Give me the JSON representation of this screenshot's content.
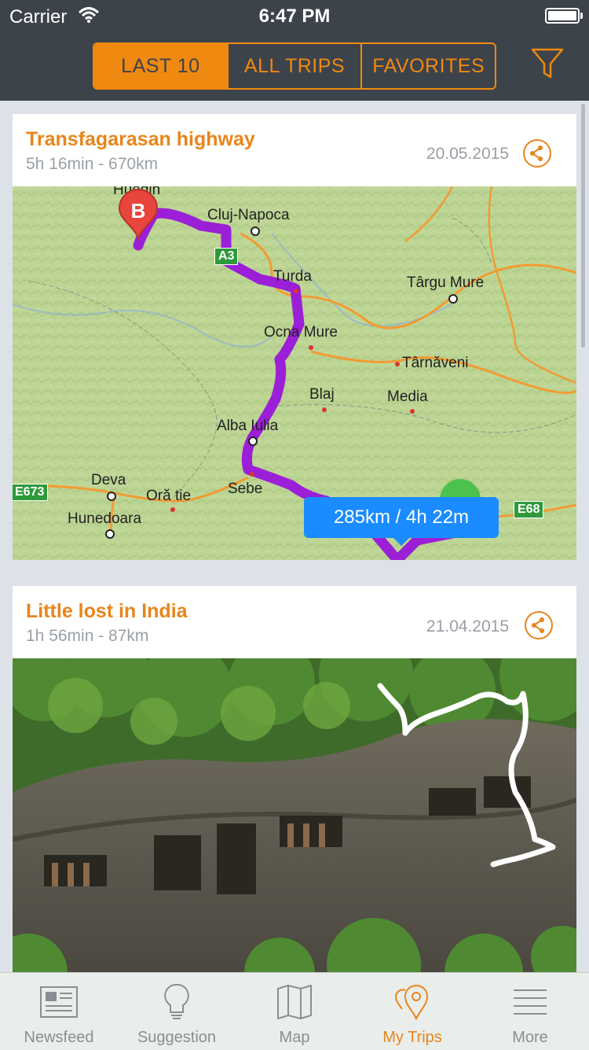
{
  "status_bar": {
    "carrier": "Carrier",
    "time": "6:47 PM"
  },
  "segments": [
    {
      "label": "LAST 10",
      "active": true
    },
    {
      "label": "ALL TRIPS",
      "active": false
    },
    {
      "label": "FAVORITES",
      "active": false
    }
  ],
  "trips": [
    {
      "title": "Transfagarasan highway",
      "subtitle": "5h 16min - 670km",
      "date": "20.05.2015",
      "map": {
        "route_badge": "285km / 4h 22m",
        "marker_b": "B",
        "places": {
          "huedin": "Huedin",
          "cluj": "Cluj-Napoca",
          "turda": "Turda",
          "targu": "Târgu Mure",
          "ocna": "Ocna Mure",
          "tarnaveni": "Târnăveni",
          "blaj": "Blaj",
          "media": "Media",
          "alba": "Alba Iulia",
          "deva": "Deva",
          "orastie": "Oră tie",
          "sebe": "Sebe",
          "hunedoara": "Hunedoara"
        },
        "roads": {
          "a3": "A3",
          "e673": "E673",
          "e68": "E68"
        }
      }
    },
    {
      "title": "Little lost in India",
      "subtitle": "1h 56min - 87km",
      "date": "21.04.2015"
    }
  ],
  "tabs": [
    {
      "label": "Newsfeed",
      "icon": "newsfeed-icon"
    },
    {
      "label": "Suggestion",
      "icon": "lightbulb-icon"
    },
    {
      "label": "Map",
      "icon": "map-icon"
    },
    {
      "label": "My Trips",
      "icon": "pins-icon",
      "active": true
    },
    {
      "label": "More",
      "icon": "menu-icon"
    }
  ],
  "colors": {
    "accent": "#e8851b",
    "header": "#3d434b",
    "route": "#9b1fd6",
    "badge": "#1a8cff"
  }
}
